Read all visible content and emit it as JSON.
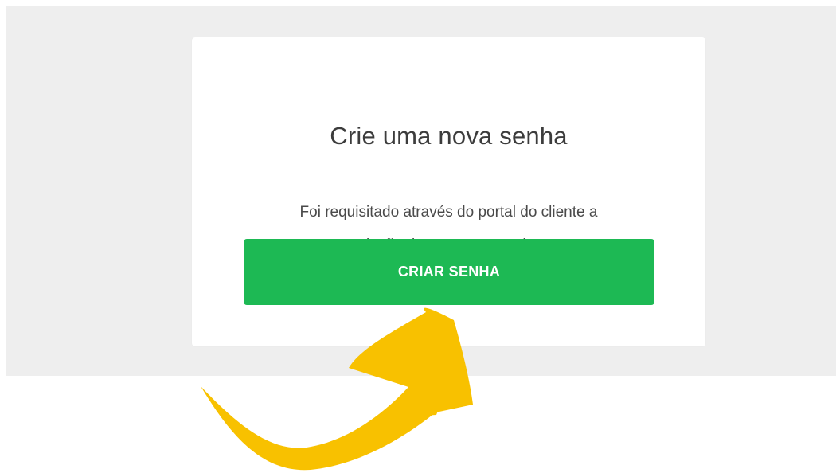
{
  "card": {
    "title": "Crie uma nova senha",
    "message_line_1": "Foi requisitado através do portal do cliente a",
    "message_line_2": "criação de uma nova senha.",
    "button_label": "CRIAR SENHA"
  },
  "icons": {
    "pointer": "curved-arrow-icon"
  },
  "colors": {
    "page_background": "#ffffff",
    "panel_background": "#eeeeee",
    "card_background": "#ffffff",
    "button": "#1db954",
    "button_text": "#ffffff",
    "title_text": "#3c3c3c",
    "body_text": "#4a4a4a",
    "arrow": "#f8c100"
  }
}
